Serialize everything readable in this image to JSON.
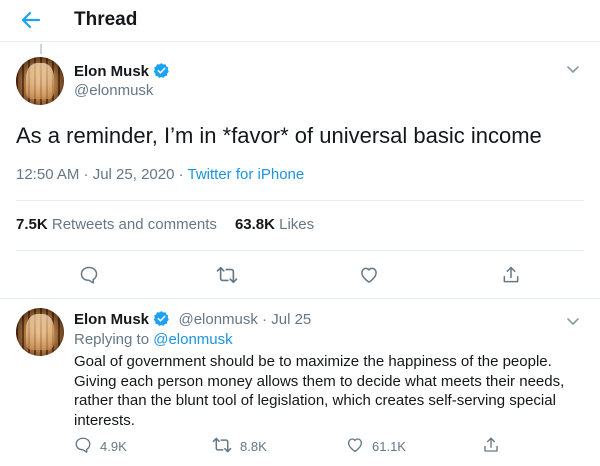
{
  "header": {
    "title": "Thread"
  },
  "tweet": {
    "name": "Elon Musk",
    "handle": "@elonmusk",
    "text": "As a reminder, I’m in *favor* of universal basic income",
    "time": "12:50 AM · Jul 25, 2020 · ",
    "source": "Twitter for iPhone",
    "retweets_count": "7.5K",
    "retweets_label": " Retweets and comments",
    "likes_count": "63.8K",
    "likes_label": " Likes"
  },
  "reply": {
    "name": "Elon Musk",
    "handle_date": "@elonmusk · Jul 25",
    "replying_prefix": "Replying to ",
    "replying_to": "@elonmusk",
    "lines": [
      "Goal of government should be to maximize the happiness of the people.",
      "Giving each person money allows them to decide what meets their needs,",
      "rather than the blunt tool of legislation, which creates self-serving special",
      "interests."
    ],
    "reply_count": "4.9K",
    "retweet_count": "8.8K",
    "like_count": "61.1K"
  },
  "colors": {
    "accent": "#1da1f2",
    "link": "#1b95e0",
    "muted": "#657786",
    "text": "#14171a"
  }
}
